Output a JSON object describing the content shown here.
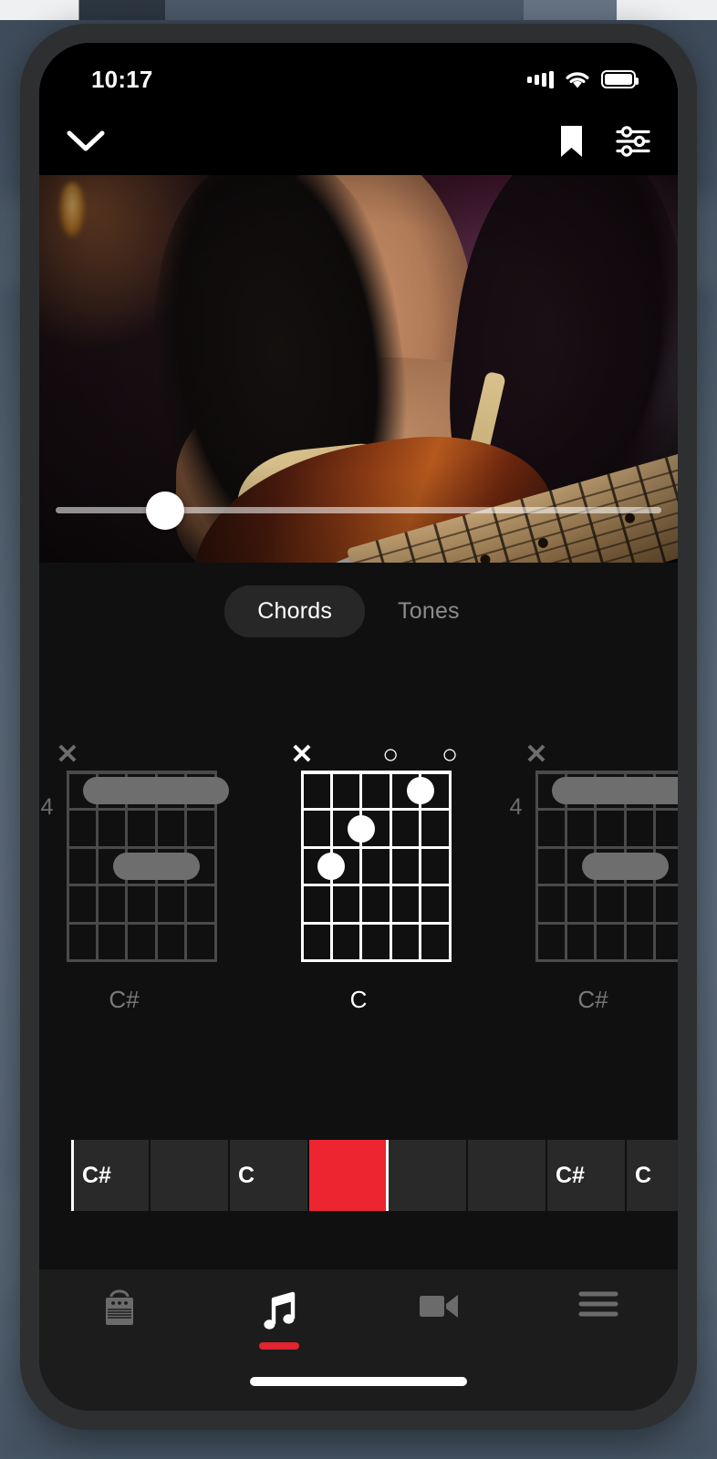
{
  "status_bar": {
    "time": "10:17",
    "signal_icon": "cellular-signal-icon",
    "wifi_icon": "wifi-icon",
    "battery_icon": "battery-full-icon"
  },
  "top_bar": {
    "collapse_icon": "chevron-down-icon",
    "bookmark_icon": "bookmark-icon",
    "settings_icon": "sliders-settings-icon"
  },
  "player": {
    "seek_value_percent": 18,
    "thumb_icon": "seek-thumb"
  },
  "tabs": {
    "items": [
      {
        "label": "Chords",
        "active": true
      },
      {
        "label": "Tones",
        "active": false
      }
    ]
  },
  "chords": [
    {
      "name": "C#",
      "active": false,
      "start_fret": "4",
      "markers": [
        {
          "symbol": "✕",
          "string": 1
        }
      ],
      "barres": [
        {
          "fret": 1,
          "from_string": 2,
          "to_string": 6
        },
        {
          "fret": 3,
          "from_string": 3,
          "to_string": 5
        }
      ],
      "dots": []
    },
    {
      "name": "C",
      "active": true,
      "start_fret": "",
      "markers": [
        {
          "symbol": "✕",
          "string": 1
        },
        {
          "symbol": "○",
          "string": 4
        },
        {
          "symbol": "○",
          "string": 6
        }
      ],
      "barres": [],
      "dots": [
        {
          "fret": 1,
          "string": 5
        },
        {
          "fret": 2,
          "string": 3
        },
        {
          "fret": 3,
          "string": 2
        }
      ]
    },
    {
      "name": "C#",
      "active": false,
      "start_fret": "4",
      "markers": [
        {
          "symbol": "✕",
          "string": 1
        }
      ],
      "barres": [
        {
          "fret": 1,
          "from_string": 2,
          "to_string": 6
        },
        {
          "fret": 3,
          "from_string": 3,
          "to_string": 5
        }
      ],
      "dots": []
    }
  ],
  "timeline": {
    "playhead_color": "#EC2530",
    "cells": [
      {
        "label": "C#",
        "playhead": false,
        "start": true
      },
      {
        "label": "",
        "playhead": false,
        "start": false
      },
      {
        "label": "C",
        "playhead": false,
        "start": false
      },
      {
        "label": "",
        "playhead": true,
        "start": false
      },
      {
        "label": "",
        "playhead": false,
        "start": false
      },
      {
        "label": "",
        "playhead": false,
        "start": false
      },
      {
        "label": "C#",
        "playhead": false,
        "start": false
      },
      {
        "label": "C",
        "playhead": false,
        "start": false
      }
    ]
  },
  "bottom_nav": {
    "active_color": "#E02430",
    "items": [
      {
        "icon": "amp-icon",
        "active": false
      },
      {
        "icon": "music-note-icon",
        "active": true
      },
      {
        "icon": "video-camera-icon",
        "active": false
      },
      {
        "icon": "hamburger-menu-icon",
        "active": false
      }
    ]
  }
}
